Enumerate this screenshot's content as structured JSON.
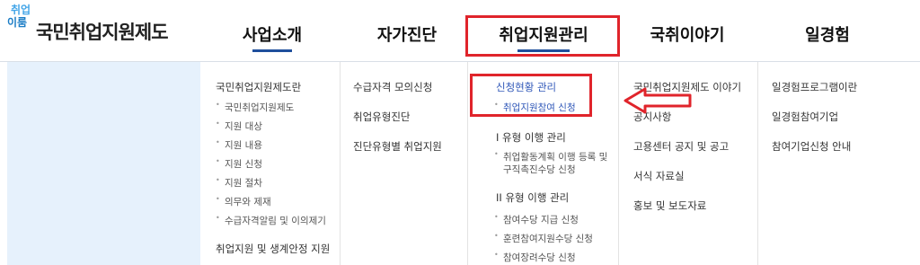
{
  "logo": {
    "mark_line1": "취업",
    "mark_line2": "이룸",
    "title": "국민취업지원제도"
  },
  "nav": [
    {
      "label": "사업소개"
    },
    {
      "label": "자가진단"
    },
    {
      "label": "취업지원관리"
    },
    {
      "label": "국취이야기"
    },
    {
      "label": "일경험"
    }
  ],
  "menu": {
    "col1": {
      "heading": "국민취업지원제도란",
      "items": [
        "국민취업지원제도",
        "지원 대상",
        "지원 내용",
        "지원 신청",
        "지원 절차",
        "의무와 제재",
        "수급자격알림 및 이의제기"
      ],
      "footer": "취업지원 및 생계안정 지원"
    },
    "col2": {
      "items": [
        "수급자격 모의신청",
        "취업유형진단",
        "진단유형별 취업지원"
      ]
    },
    "col3": {
      "heading1": "신청현황 관리",
      "item1": "취업지원참여 신청",
      "heading2": "I 유형 이행 관리",
      "item2a": "취업활동계획 이행 등록 및",
      "item2b": "구직촉진수당 신청",
      "heading3": "II 유형 이행 관리",
      "items3": [
        "참여수당 지급 신청",
        "훈련참여지원수당 신청",
        "참여장려수당 신청"
      ]
    },
    "col4": {
      "items": [
        "국민취업지원제도 이야기",
        "공지사항",
        "고용센터 공지 및 공고",
        "서식 자료실",
        "홍보 및 보도자료"
      ]
    },
    "col5": {
      "items": [
        "일경험프로그램이란",
        "일경험참여기업",
        "참여기업신청 안내"
      ]
    }
  },
  "colors": {
    "accent": "#1f4f9c",
    "highlight": "#e0242b",
    "panel": "#e6f1fc",
    "link_blue": "#2f57b8"
  }
}
